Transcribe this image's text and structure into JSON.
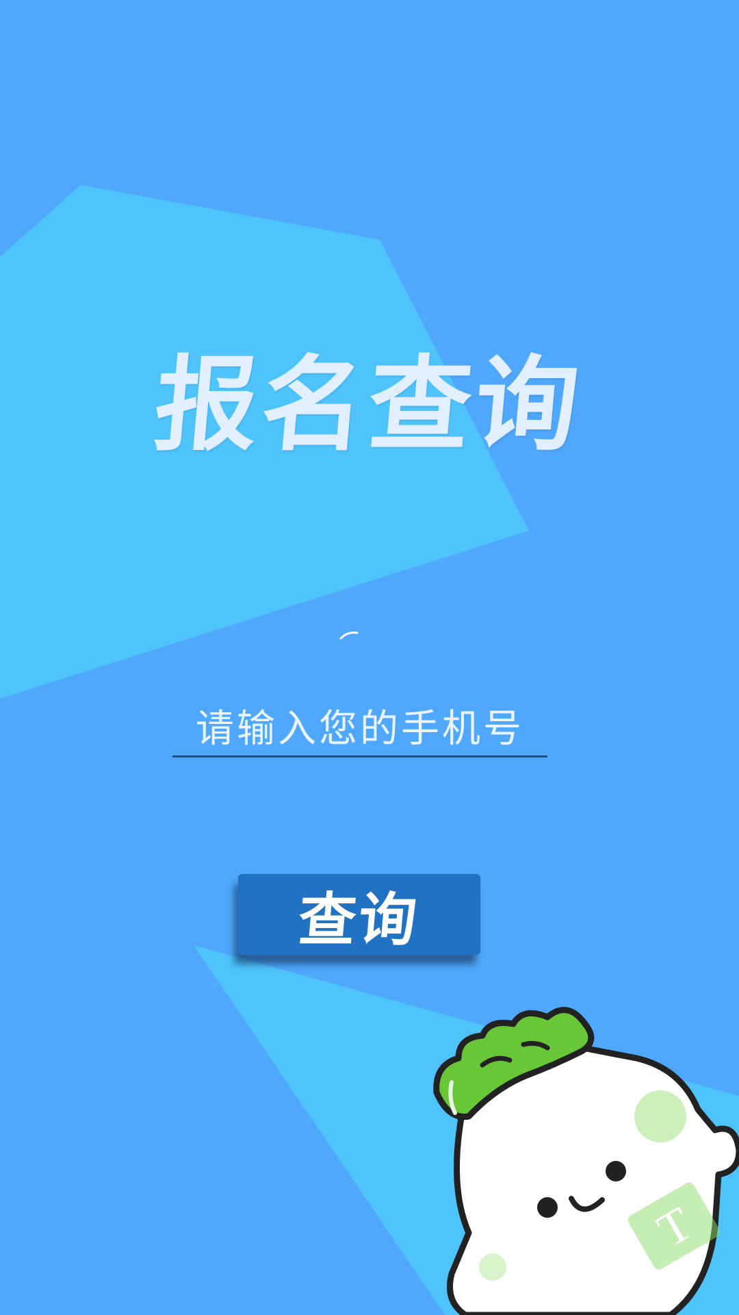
{
  "page": {
    "title": "报名查询",
    "input_placeholder": "请输入您的手机号",
    "input_value": "",
    "button_label": "查询",
    "watermark_letter": "T"
  },
  "colors": {
    "background": "#4fa8fb",
    "shape_light": "#4fc3fb",
    "button": "#2272c3",
    "title_text": "#e2efff",
    "mascot_leaf": "#68c736"
  },
  "icons": [
    "radish-mascot-illustration",
    "watermark-badge"
  ]
}
